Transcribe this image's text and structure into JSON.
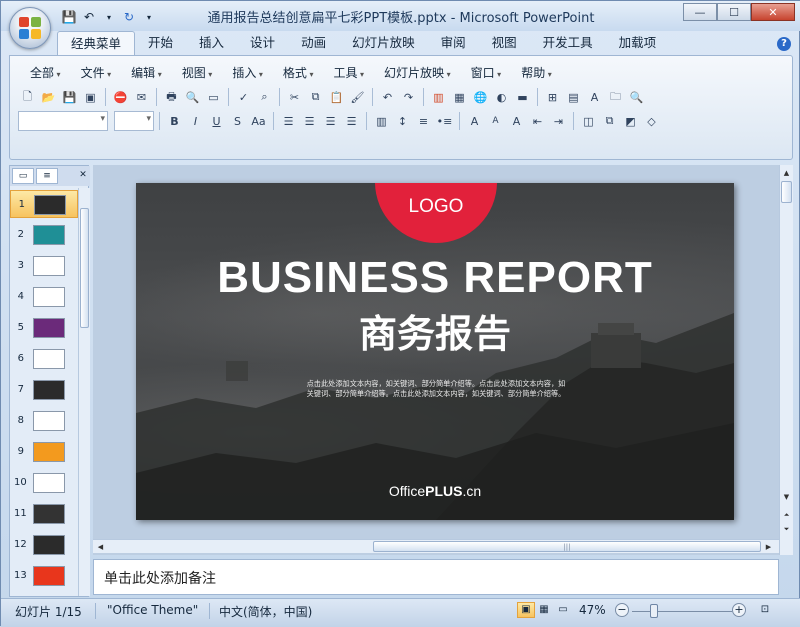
{
  "window": {
    "title": "通用报告总结创意扁平七彩PPT模板.pptx - Microsoft PowerPoint",
    "minimize": "—",
    "maximize": "☐",
    "close": "✕"
  },
  "ribbon_tabs": [
    "经典菜单",
    "开始",
    "插入",
    "设计",
    "动画",
    "幻灯片放映",
    "审阅",
    "视图",
    "开发工具",
    "加载项"
  ],
  "active_tab": "经典菜单",
  "classic_menus": [
    "全部",
    "文件",
    "编辑",
    "视图",
    "插入",
    "格式",
    "工具",
    "幻灯片放映",
    "窗口",
    "帮助"
  ],
  "slides_panel": {
    "numbers": [
      "1",
      "2",
      "3",
      "4",
      "5",
      "6",
      "7",
      "8",
      "9",
      "10",
      "11",
      "12",
      "13"
    ],
    "thumb_colors": [
      "#2b2b2b",
      "#1f8f96",
      "#ffffff",
      "#ffffff",
      "#6b2a7a",
      "#ffffff",
      "#2b2b2b",
      "#ffffff",
      "#f39a1e",
      "#ffffff",
      "#333333",
      "#2b2b2b",
      "#e8361c"
    ],
    "selected_index": 0
  },
  "slide": {
    "logo": "LOGO",
    "title": "BUSINESS REPORT",
    "subtitle": "商务报告",
    "body_line1": "点击此处添加文本内容，如关键词、部分简单介绍等。点击此处添加文本内容，如",
    "body_line2": "关键词、部分简单介绍等。点击此处添加文本内容，如关键词、部分简单介绍等。",
    "footer_prefix": "Office",
    "footer_bold": "PLUS",
    "footer_suffix": ".cn",
    "accent_color": "#e2213b"
  },
  "notes": {
    "placeholder": "单击此处添加备注"
  },
  "status": {
    "slide_info": "幻灯片 1/15",
    "theme": "\"Office Theme\"",
    "language": "中文(简体，中国)",
    "zoom": "47%"
  }
}
